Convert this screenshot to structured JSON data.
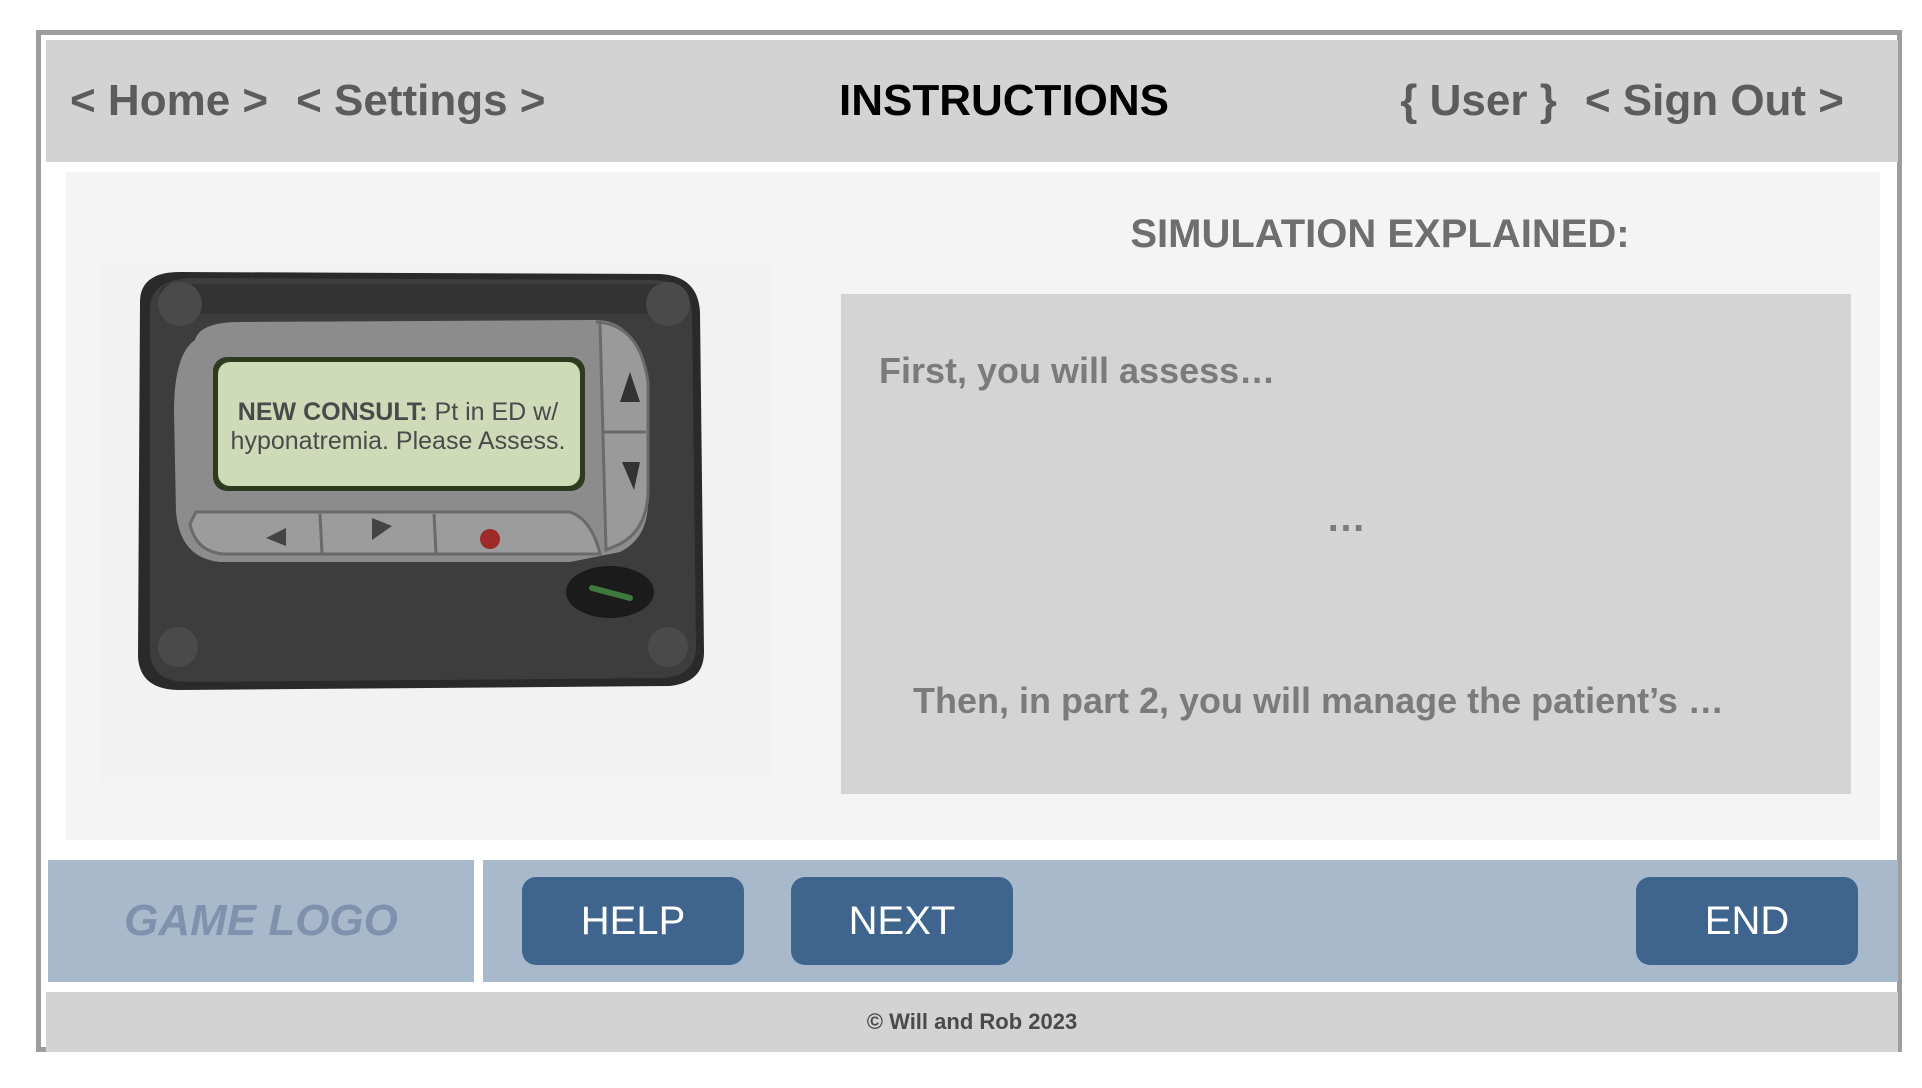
{
  "header": {
    "nav_left": [
      "< Home >",
      "< Settings >"
    ],
    "title": "INSTRUCTIONS",
    "nav_right": [
      "{ User }",
      "< Sign Out >"
    ]
  },
  "pager": {
    "message_bold": "NEW CONSULT:",
    "message_rest_line1": " Pt in ED w/",
    "message_line2": "hyponatremia. Please Assess."
  },
  "explanation": {
    "title": "SIMULATION EXPLAINED:",
    "line1": "First, you will assess…",
    "line2": "…",
    "line3": "Then, in part 2, you will manage the patient’s …"
  },
  "bottom": {
    "logo": "GAME LOGO",
    "help_label": "HELP",
    "next_label": "NEXT",
    "end_label": "END"
  },
  "footer": {
    "copyright": "© Will and Rob 2023"
  },
  "colors": {
    "header_bg": "#d3d3d3",
    "bar_bg": "#a8b9cc",
    "button_bg": "#3f658f",
    "screen_bg": "#cfdab8"
  }
}
